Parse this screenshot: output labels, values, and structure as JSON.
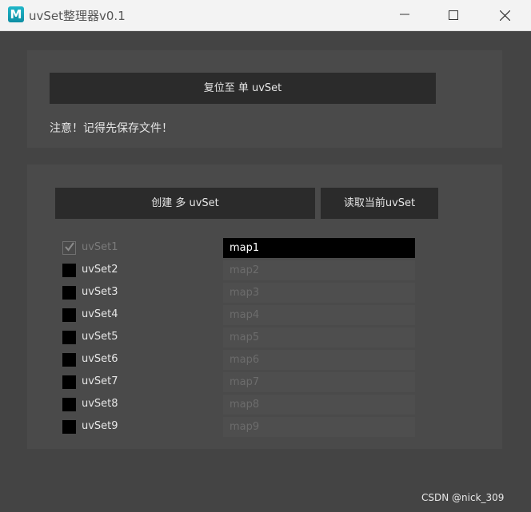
{
  "window": {
    "icon_letter": "M",
    "title": "uvSet整理器v0.1"
  },
  "top_panel": {
    "reset_button_label": "复位至 单 uvSet",
    "notice": "注意！记得先保存文件！"
  },
  "bottom_panel": {
    "create_button_label": "创建 多 uvSet",
    "read_button_label": "读取当前uvSet",
    "rows": [
      {
        "label": "uvSet1",
        "map": "map1",
        "checked": true,
        "enabled": false,
        "active": true
      },
      {
        "label": "uvSet2",
        "map": "map2",
        "checked": false,
        "enabled": true,
        "active": false
      },
      {
        "label": "uvSet3",
        "map": "map3",
        "checked": false,
        "enabled": true,
        "active": false
      },
      {
        "label": "uvSet4",
        "map": "map4",
        "checked": false,
        "enabled": true,
        "active": false
      },
      {
        "label": "uvSet5",
        "map": "map5",
        "checked": false,
        "enabled": true,
        "active": false
      },
      {
        "label": "uvSet6",
        "map": "map6",
        "checked": false,
        "enabled": true,
        "active": false
      },
      {
        "label": "uvSet7",
        "map": "map7",
        "checked": false,
        "enabled": true,
        "active": false
      },
      {
        "label": "uvSet8",
        "map": "map8",
        "checked": false,
        "enabled": true,
        "active": false
      },
      {
        "label": "uvSet9",
        "map": "map9",
        "checked": false,
        "enabled": true,
        "active": false
      }
    ]
  },
  "watermark": "CSDN @nick_309"
}
